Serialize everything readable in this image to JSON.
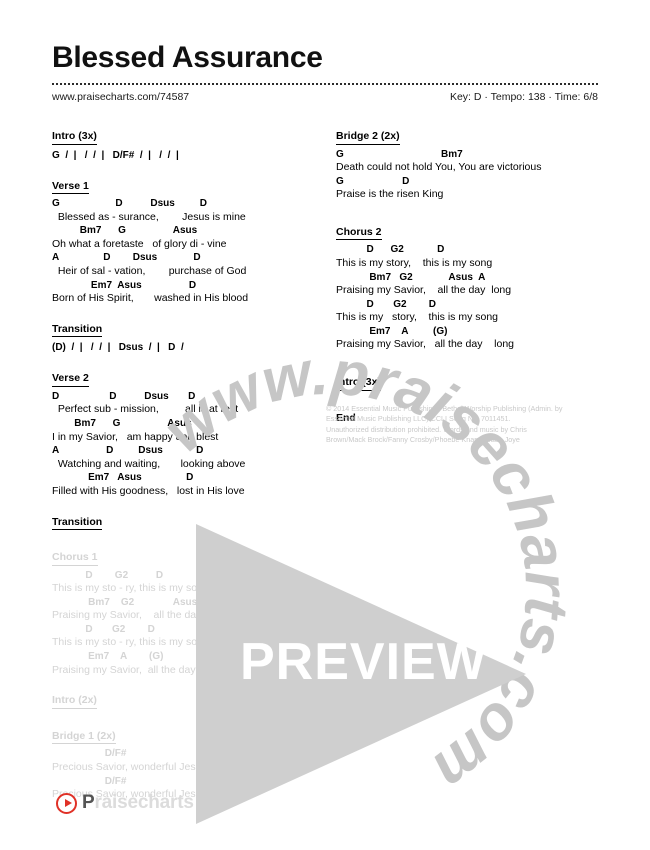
{
  "header": {
    "title": "Blessed Assurance",
    "url": "www.praisecharts.com/74587",
    "meta": "Key: D · Tempo: 138 · Time: 6/8"
  },
  "left_column": [
    {
      "name": "intro",
      "heading": "Intro (3x)",
      "underline": true,
      "faded": false,
      "bars": "G  /  |   /  /  |   D/F#  /  |   /  /  |"
    },
    {
      "name": "verse-1",
      "heading": "Verse 1",
      "underline": true,
      "faded": false,
      "lines": [
        {
          "chords": "G                    D          Dsus         D",
          "lyrics": "  Blessed as - surance,        Jesus is mine"
        },
        {
          "chords": "          Bm7      G                 Asus",
          "lyrics": "Oh what a foretaste   of glory di - vine"
        },
        {
          "chords": "A                D        Dsus             D",
          "lyrics": "  Heir of sal - vation,        purchase of God"
        },
        {
          "chords": "              Em7  Asus                 D",
          "lyrics": "Born of His Spirit,       washed in His blood"
        }
      ]
    },
    {
      "name": "transition-1",
      "heading": "Transition",
      "underline": true,
      "faded": false,
      "bars": "(D)  /  |   /  /  |   Dsus  /  |   D  /"
    },
    {
      "name": "verse-2",
      "heading": "Verse 2",
      "underline": true,
      "faded": false,
      "lines": [
        {
          "chords": "D                  D          Dsus       D",
          "lyrics": "  Perfect sub - mission,         all is at rest"
        },
        {
          "chords": "        Bm7      G                 Asus",
          "lyrics": "I in my Savior,   am happy and blest"
        },
        {
          "chords": "A                 D         Dsus            D",
          "lyrics": "  Watching and waiting,       looking above"
        },
        {
          "chords": "             Em7   Asus                D",
          "lyrics": "Filled with His goodness,   lost in His love"
        }
      ]
    },
    {
      "name": "transition-2",
      "heading": "Transition",
      "underline": true,
      "faded": false
    },
    {
      "name": "chorus-1",
      "heading": "Chorus 1",
      "underline": true,
      "faded": true,
      "lines": [
        {
          "chords": "            D        G2          D",
          "lyrics": "This is my sto - ry, this is my song"
        },
        {
          "chords": "             Bm7    G2              Asus  A",
          "lyrics": "Praising my Savior,    all the day  long"
        },
        {
          "chords": "            D       G2        D",
          "lyrics": "This is my sto - ry, this is my song"
        },
        {
          "chords": "             Em7    A        (G)",
          "lyrics": "Praising my Savior,  all the day long"
        }
      ]
    },
    {
      "name": "intro-2x",
      "heading": "Intro (2x)",
      "underline": true,
      "faded": true
    },
    {
      "name": "bridge-1",
      "heading": "Bridge 1 (2x)",
      "underline": true,
      "faded": true,
      "lines": [
        {
          "chords": "                   D/F#",
          "lyrics": "Precious Savior, wonderful Jesus"
        },
        {
          "chords": "                   D/F#",
          "lyrics": "Precious Savior, wonderful Jesus"
        }
      ]
    }
  ],
  "right_column": [
    {
      "name": "bridge-2",
      "heading": "Bridge 2 (2x)",
      "underline": true,
      "faded": false,
      "lines": [
        {
          "chords": "G                                   Bm7",
          "lyrics": "Death could not hold You, You are victorious"
        },
        {
          "chords": "G                     D",
          "lyrics": "Praise is the risen King"
        }
      ]
    },
    {
      "name": "chorus-2",
      "heading": "Chorus 2",
      "underline": true,
      "faded": false,
      "lines": [
        {
          "chords": "           D      G2            D",
          "lyrics": "This is my story,    this is my song"
        },
        {
          "chords": "            Bm7   G2             Asus  A",
          "lyrics": "Praising my Savior,    all the day  long"
        },
        {
          "chords": "           D       G2        D",
          "lyrics": "This is my   story,    this is my song"
        },
        {
          "chords": "            Em7    A         (G)",
          "lyrics": "Praising my Savior,   all the day    long"
        }
      ]
    },
    {
      "name": "intro-3x-end",
      "heading": "Intro (3x)",
      "underline": true,
      "faded": false
    },
    {
      "name": "end",
      "heading": "End",
      "underline": false,
      "faded": false
    }
  ],
  "copyright": {
    "line1": "© 2014 Essential Music Publishing / Bethel Worship Publishing (Admin. by",
    "line2": "Essential Music Publishing LLC) CCLI Song No. 7011451.",
    "line3": "Unauthorized distribution prohibited. Words and music by Chris",
    "line4": "Brown/Mack Brock/Fanny Crosby/Phoebe Knapp/Wade Joye"
  },
  "watermark": {
    "ring_text": "www.praisecharts.com",
    "preview_label": "PREVIEW"
  },
  "footer": {
    "logo_strong": "P",
    "logo_rest": "raisecharts"
  }
}
